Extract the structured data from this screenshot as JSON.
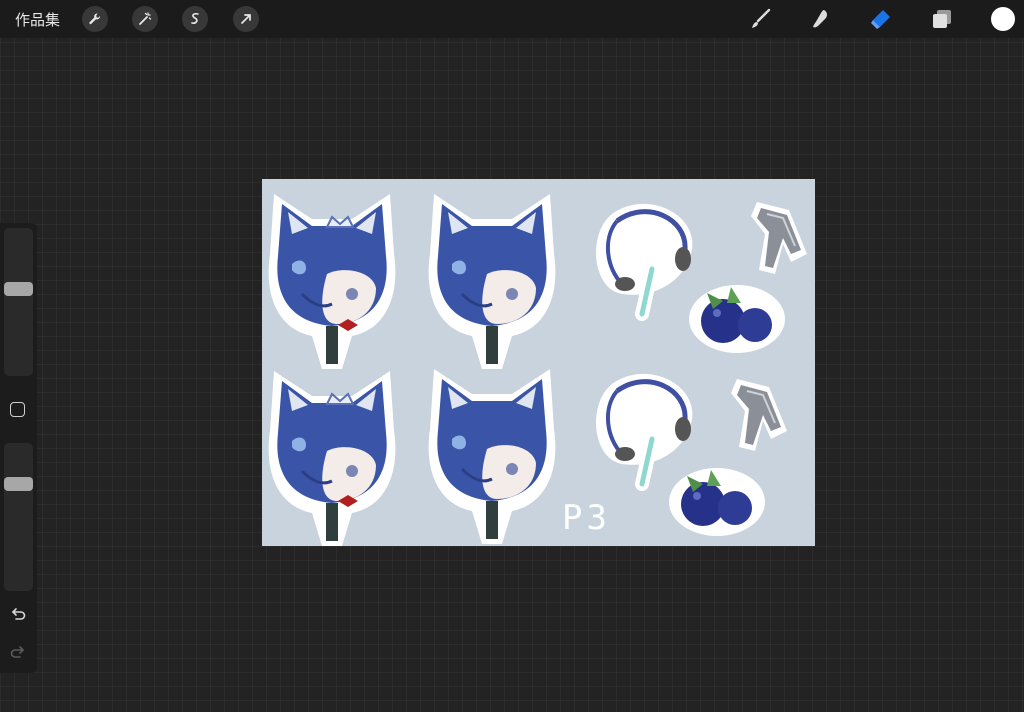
{
  "topbar": {
    "gallery_label": "作品集",
    "left_tools": [
      "wrench-icon",
      "magic-wand-icon",
      "selection-icon",
      "transform-arrow-icon"
    ],
    "right_tools": [
      "brush-icon",
      "smudge-icon",
      "eraser-icon",
      "layers-icon"
    ],
    "active_tool": "eraser",
    "active_color": "#ffffff",
    "accent_color": "#1a73e8"
  },
  "sidebar": {
    "brush_size_level": 0.6,
    "opacity_level": 0.75
  },
  "canvas": {
    "background_color": "#c8d3dd",
    "label_text": "P3"
  }
}
